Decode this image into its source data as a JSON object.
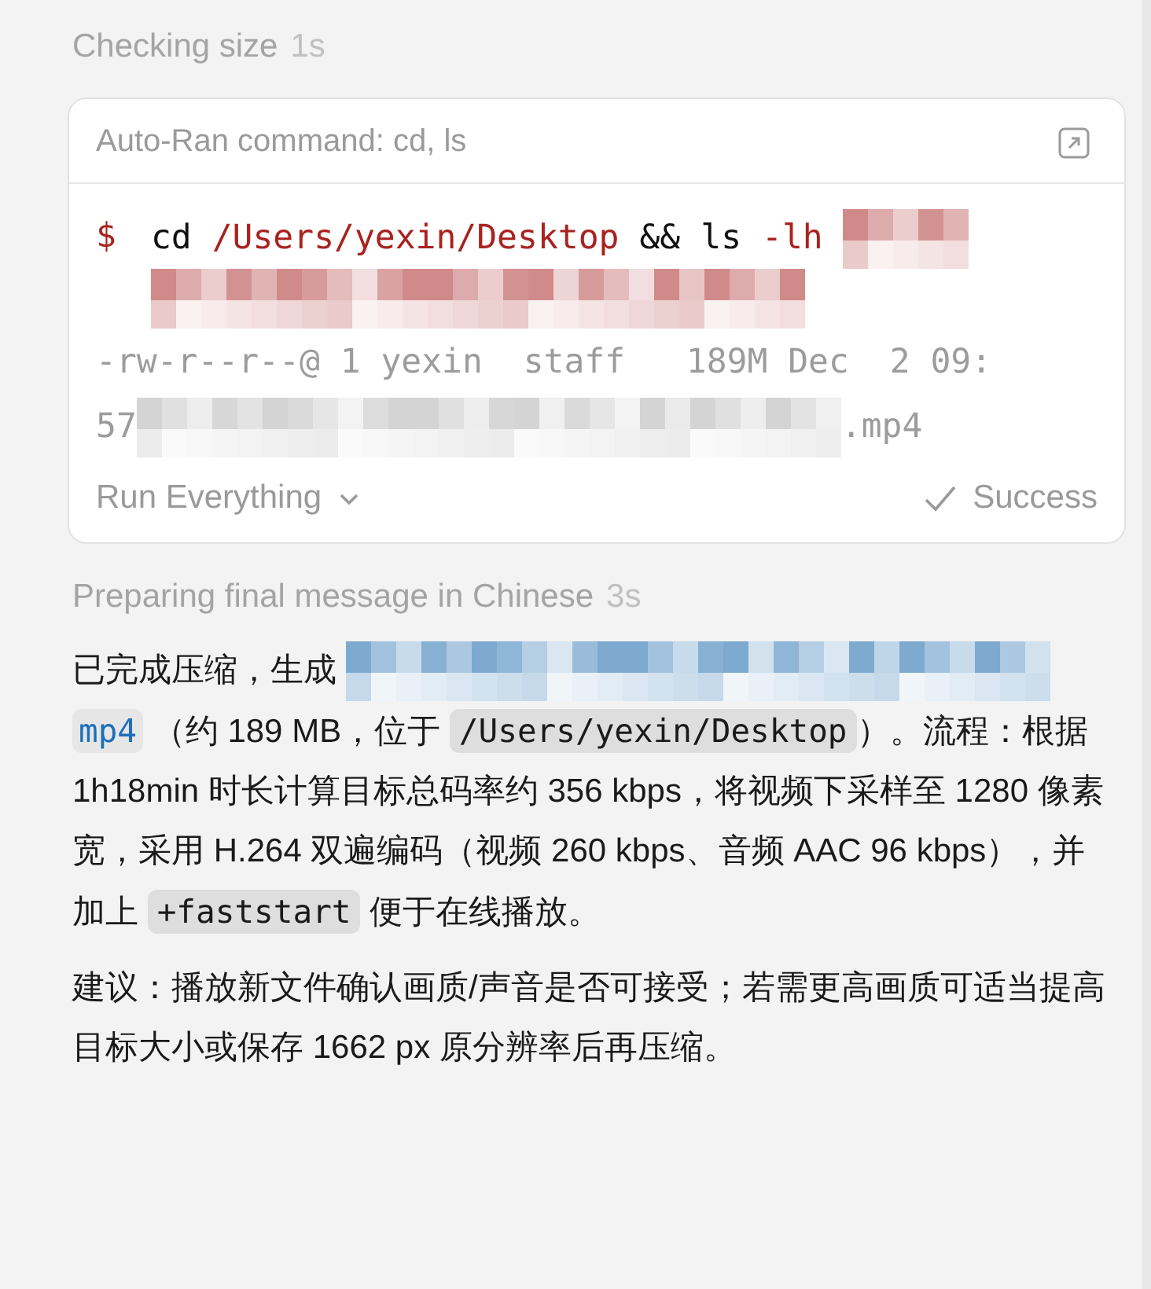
{
  "status_before": {
    "label": "Checking size",
    "time": "1s"
  },
  "terminal": {
    "title": "Auto-Ran command: cd, ls",
    "prompt": "$",
    "command": [
      {
        "kind": "plain",
        "text": "cd"
      },
      {
        "kind": "accent",
        "text": "/Users/yexin/Desktop"
      },
      {
        "kind": "plain",
        "text": "&&"
      },
      {
        "kind": "plain",
        "text": "ls"
      },
      {
        "kind": "accent",
        "text": "-lh"
      },
      {
        "kind": "smudge",
        "color": "#d08a8a"
      },
      {
        "kind": "mosaic",
        "color": "#d08a8a"
      }
    ],
    "output": [
      [
        {
          "kind": "plain",
          "text": "-rw-r--r--@ 1 yexin  staff   189M Dec  2 09:"
        }
      ],
      [
        {
          "kind": "plain",
          "text": "57"
        },
        {
          "kind": "mosaic",
          "color": "#d4d4d4"
        },
        {
          "kind": "plain",
          "text": ".mp4"
        }
      ]
    ],
    "run_mode": "Run Everything",
    "result": "Success"
  },
  "status_after": {
    "label": "Preparing final message in Chinese",
    "time": "3s"
  },
  "paragraphs": [
    [
      {
        "kind": "text",
        "text": "已完成压缩，生成 "
      },
      {
        "kind": "mosaic",
        "color": "#7eaad0"
      },
      {
        "kind": "link",
        "text": "mp4"
      },
      {
        "kind": "text",
        "text": " （约 189 MB，位于 "
      },
      {
        "kind": "code",
        "text": "/Users/yexin/Desktop"
      },
      {
        "kind": "text",
        "text": "）。流程：根据 1h18min 时长计算目标总码率约 356 kbps，将视频下采样至 1280 像素宽，采用 H.264 双遍编码（视频 260 kbps、音频 AAC 96 kbps），并加上 "
      },
      {
        "kind": "code",
        "text": "+faststart"
      },
      {
        "kind": "text",
        "text": " 便于在线播放。"
      }
    ],
    [
      {
        "kind": "text",
        "text": "建议：播放新文件确认画质/声音是否可接受；若需更高画质可适当提高目标大小或保存 1662 px 原分辨率后再压缩。"
      }
    ]
  ]
}
